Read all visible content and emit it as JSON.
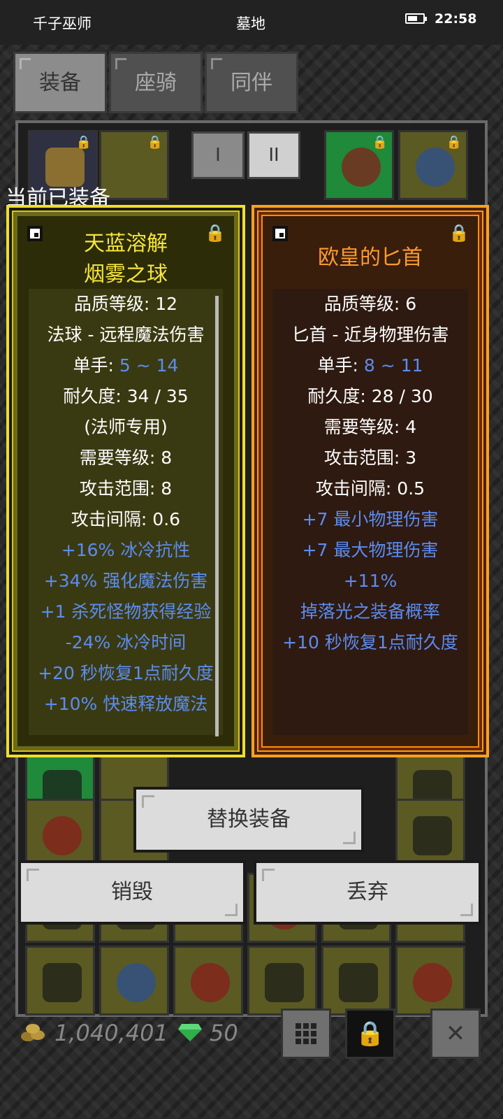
{
  "status_bar": {
    "app_name": "千子巫师",
    "location": "墓地",
    "time": "22:58"
  },
  "tabs": [
    {
      "label": "装备",
      "active": true
    },
    {
      "label": "座骑",
      "active": false
    },
    {
      "label": "同伴",
      "active": false
    }
  ],
  "pager": {
    "page1_label": "I",
    "page2_label": "II"
  },
  "equipped_label": "当前已装备",
  "current_item": {
    "title_line1": "天蓝溶解",
    "title_line2": "烟雾之球",
    "quality": "品质等级: 12",
    "type": "法球 - 远程魔法伤害",
    "hand_label": "单手: ",
    "hand_damage": "5 ~ 14",
    "durability": "耐久度: 34 / 35",
    "class_req": "(法师专用)",
    "level_req": "需要等级: 8",
    "range": "攻击范围: 8",
    "interval": "攻击间隔: 0.6",
    "affixes": [
      "+16% 冰冷抗性",
      "+34% 强化魔法伤害",
      "+1 杀死怪物获得经验",
      "-24% 冰冷时间",
      "+20 秒恢复1点耐久度",
      "+10% 快速释放魔法"
    ],
    "border_color": "#f0de2e"
  },
  "new_item": {
    "title": "欧皇的匕首",
    "quality": "品质等级: 6",
    "type": "匕首 - 近身物理伤害",
    "hand_label": "单手: ",
    "hand_damage": "8 ~ 11",
    "durability": "耐久度: 28 / 30",
    "level_req": "需要等级: 4",
    "range": "攻击范围: 3",
    "interval": "攻击间隔: 0.5",
    "affixes": [
      "+7 最小物理伤害",
      "+7 最大物理伤害",
      "+11%",
      "掉落光之装备概率",
      "+10 秒恢复1点耐久度"
    ],
    "border_color": "#ffa020"
  },
  "actions": {
    "replace_label": "替换装备",
    "destroy_label": "销毁",
    "discard_label": "丢弃"
  },
  "currency": {
    "gold": "1,040,401",
    "gems": "50"
  },
  "icons": {
    "grid": "grid-icon",
    "lock": "lock-icon",
    "close": "close-icon"
  }
}
